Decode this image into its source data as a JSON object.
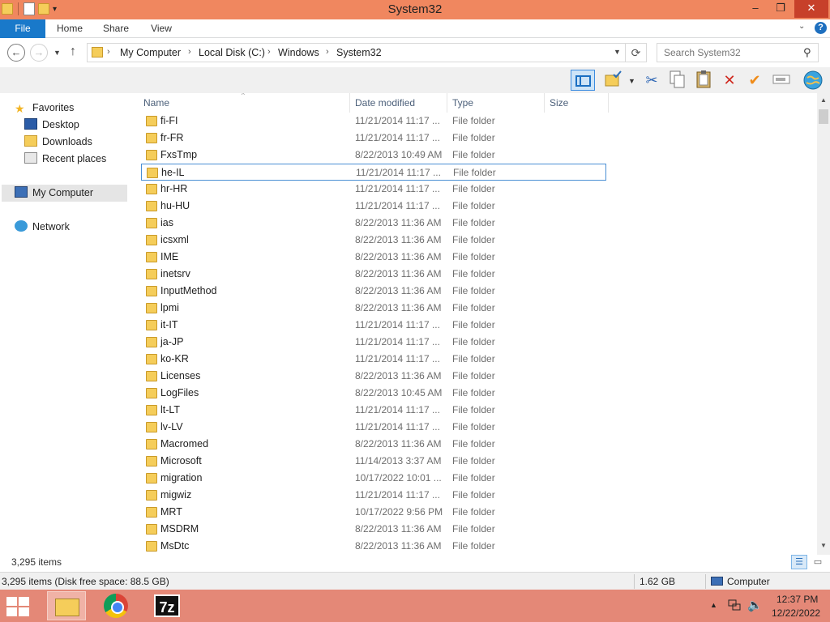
{
  "window": {
    "title": "System32",
    "minimize": "–",
    "maximize": "❐",
    "close": "✕"
  },
  "ribbon": {
    "tabs": [
      {
        "label": "File"
      },
      {
        "label": "Home"
      },
      {
        "label": "Share"
      },
      {
        "label": "View"
      }
    ],
    "expand_icon": "⌄",
    "help": "?"
  },
  "address": {
    "crumbs": [
      "My Computer",
      "Local Disk (C:)",
      "Windows",
      "System32"
    ],
    "separator": "›"
  },
  "search": {
    "placeholder": "Search System32"
  },
  "navpane": {
    "favorites": "Favorites",
    "desktop": "Desktop",
    "downloads": "Downloads",
    "recent": "Recent places",
    "mycomputer": "My Computer",
    "network": "Network"
  },
  "columns": {
    "name": "Name",
    "date": "Date modified",
    "type": "Type",
    "size": "Size"
  },
  "files": [
    {
      "name": "fi-FI",
      "date": "11/21/2014 11:17 ...",
      "type": "File folder"
    },
    {
      "name": "fr-FR",
      "date": "11/21/2014 11:17 ...",
      "type": "File folder"
    },
    {
      "name": "FxsTmp",
      "date": "8/22/2013 10:49 AM",
      "type": "File folder"
    },
    {
      "name": "he-IL",
      "date": "11/21/2014 11:17 ...",
      "type": "File folder",
      "selected": true
    },
    {
      "name": "hr-HR",
      "date": "11/21/2014 11:17 ...",
      "type": "File folder"
    },
    {
      "name": "hu-HU",
      "date": "11/21/2014 11:17 ...",
      "type": "File folder"
    },
    {
      "name": "ias",
      "date": "8/22/2013 11:36 AM",
      "type": "File folder"
    },
    {
      "name": "icsxml",
      "date": "8/22/2013 11:36 AM",
      "type": "File folder"
    },
    {
      "name": "IME",
      "date": "8/22/2013 11:36 AM",
      "type": "File folder"
    },
    {
      "name": "inetsrv",
      "date": "8/22/2013 11:36 AM",
      "type": "File folder"
    },
    {
      "name": "InputMethod",
      "date": "8/22/2013 11:36 AM",
      "type": "File folder"
    },
    {
      "name": "lpmi",
      "date": "8/22/2013 11:36 AM",
      "type": "File folder"
    },
    {
      "name": "it-IT",
      "date": "11/21/2014 11:17 ...",
      "type": "File folder"
    },
    {
      "name": "ja-JP",
      "date": "11/21/2014 11:17 ...",
      "type": "File folder"
    },
    {
      "name": "ko-KR",
      "date": "11/21/2014 11:17 ...",
      "type": "File folder"
    },
    {
      "name": "Licenses",
      "date": "8/22/2013 11:36 AM",
      "type": "File folder"
    },
    {
      "name": "LogFiles",
      "date": "8/22/2013 10:45 AM",
      "type": "File folder"
    },
    {
      "name": "lt-LT",
      "date": "11/21/2014 11:17 ...",
      "type": "File folder"
    },
    {
      "name": "lv-LV",
      "date": "11/21/2014 11:17 ...",
      "type": "File folder"
    },
    {
      "name": "Macromed",
      "date": "8/22/2013 11:36 AM",
      "type": "File folder"
    },
    {
      "name": "Microsoft",
      "date": "11/14/2013 3:37 AM",
      "type": "File folder"
    },
    {
      "name": "migration",
      "date": "10/17/2022 10:01 ...",
      "type": "File folder"
    },
    {
      "name": "migwiz",
      "date": "11/21/2014 11:17 ...",
      "type": "File folder"
    },
    {
      "name": "MRT",
      "date": "10/17/2022 9:56 PM",
      "type": "File folder"
    },
    {
      "name": "MSDRM",
      "date": "8/22/2013 11:36 AM",
      "type": "File folder"
    },
    {
      "name": "MsDtc",
      "date": "8/22/2013 11:36 AM",
      "type": "File folder"
    }
  ],
  "status": {
    "item_count": "3,295 items",
    "summary": "3,295 items (Disk free space: 88.5 GB)",
    "size": "1.62 GB",
    "location": "Computer"
  },
  "taskbar": {
    "seven_zip": "7z",
    "time": "12:37 PM",
    "date": "12/22/2022"
  }
}
